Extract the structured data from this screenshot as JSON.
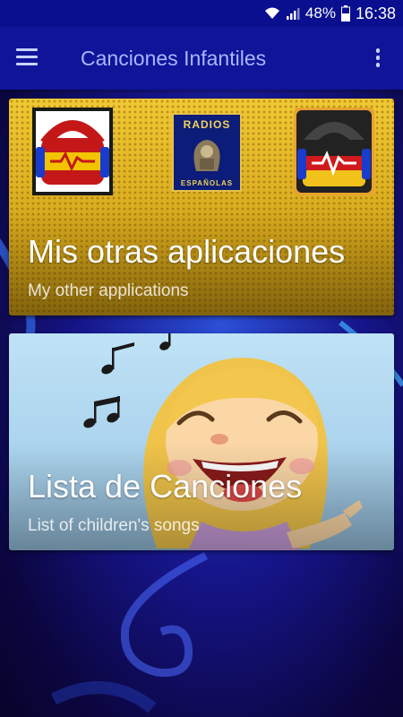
{
  "status": {
    "battery_percent": "48%",
    "time": "16:38"
  },
  "app_bar": {
    "title": "Canciones Infantiles"
  },
  "cards": [
    {
      "title": "Mis otras aplicaciones",
      "subtitle": "My other applications",
      "logo_text_top": "RADIOS",
      "logo_text_bottom": "ESPAÑOLAS"
    },
    {
      "title": "Lista de Canciones",
      "subtitle": "List of children's songs"
    }
  ],
  "colors": {
    "app_bar": "#0f1499",
    "status_bar": "#0a0f8f",
    "apps_card": "#e0b42a",
    "songs_card": "#bfe2f6"
  }
}
